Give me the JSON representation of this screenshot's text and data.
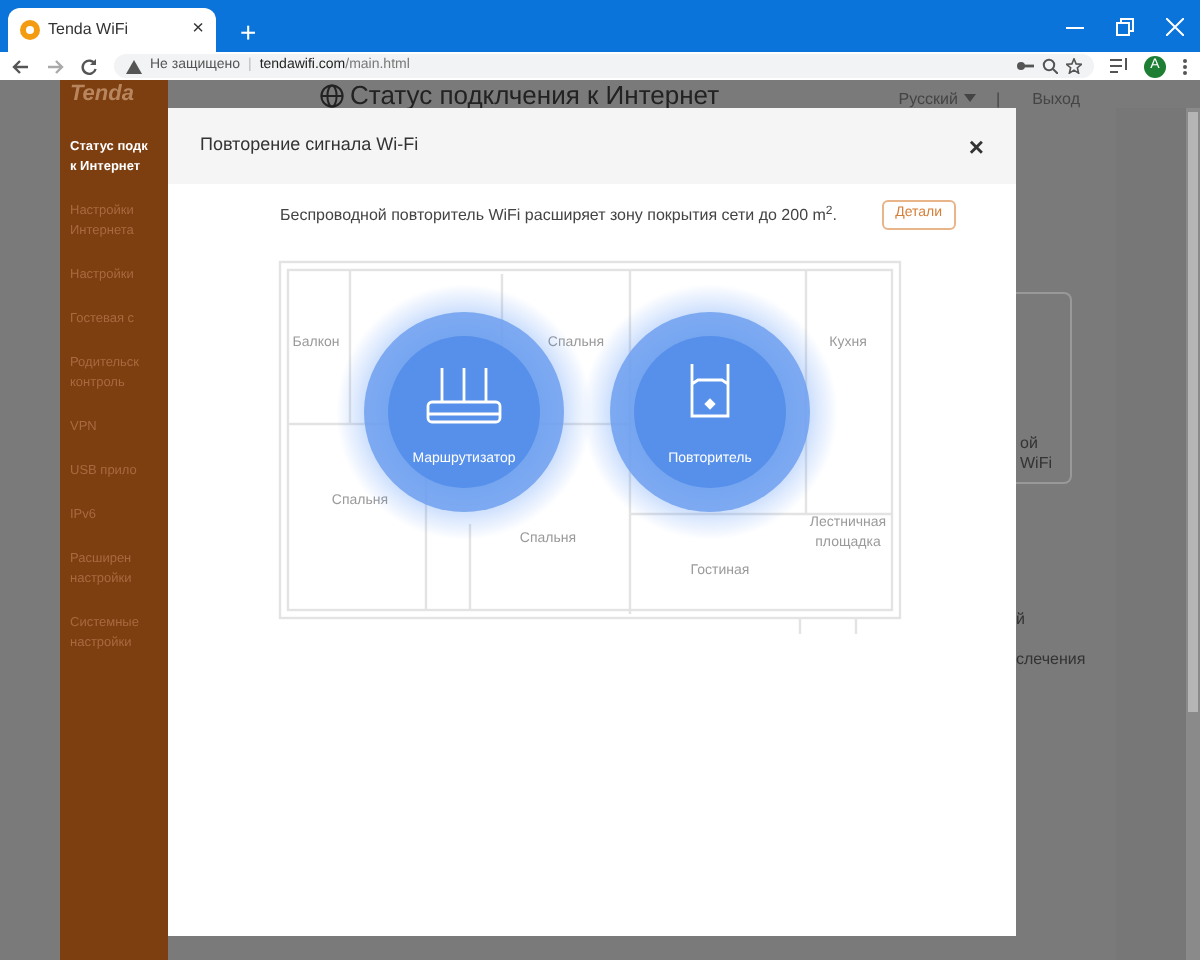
{
  "browser": {
    "tab": {
      "title": "Tenda WiFi",
      "close": "×"
    },
    "new_tab": "+",
    "address": {
      "security": "Не защищено",
      "url_separator": "|",
      "url_host": "tendawifi.com",
      "url_path": "/main.html"
    },
    "avatar": "A"
  },
  "page": {
    "logo": "Tenda",
    "heading": "Статус подклчения к Интернет",
    "language": "Русский",
    "separator": "|",
    "logout": "Выход",
    "sidebar": [
      {
        "lines": [
          "Статус подк",
          "к Интернет"
        ],
        "selected": true
      },
      {
        "lines": [
          "Настройки",
          "Интернета"
        ],
        "selected": false
      },
      {
        "lines": [
          "Настройки"
        ],
        "selected": false
      },
      {
        "lines": [
          "Гостевая с"
        ],
        "selected": false
      },
      {
        "lines": [
          "Родительск",
          "контроль"
        ],
        "selected": false
      },
      {
        "lines": [
          "VPN"
        ],
        "selected": false
      },
      {
        "lines": [
          "USB прило"
        ],
        "selected": false
      },
      {
        "lines": [
          "IPv6"
        ],
        "selected": false
      },
      {
        "lines": [
          "Расширен",
          "настройки"
        ],
        "selected": false
      },
      {
        "lines": [
          "Системные",
          "настройки"
        ],
        "selected": false
      }
    ],
    "card_lines": [
      "ой",
      "WiFi"
    ],
    "texts": [
      "й",
      "слечения"
    ]
  },
  "dialog": {
    "title": "Повторение сигнала Wi-Fi",
    "close": "×",
    "description": "Беспроводной повторитель WiFi расширяет зону покрытия сети до 200 m$^{2}$.",
    "details_button": "Детали",
    "rooms": [
      "Балкон",
      "Спальня",
      "Кухня",
      "Спальня",
      "Спальня",
      "Гостиная",
      "Лестничная площадка"
    ],
    "devices": [
      {
        "kind": "router",
        "label": "Маршрутизатор"
      },
      {
        "kind": "repeater",
        "label": "Повторитель"
      }
    ]
  }
}
